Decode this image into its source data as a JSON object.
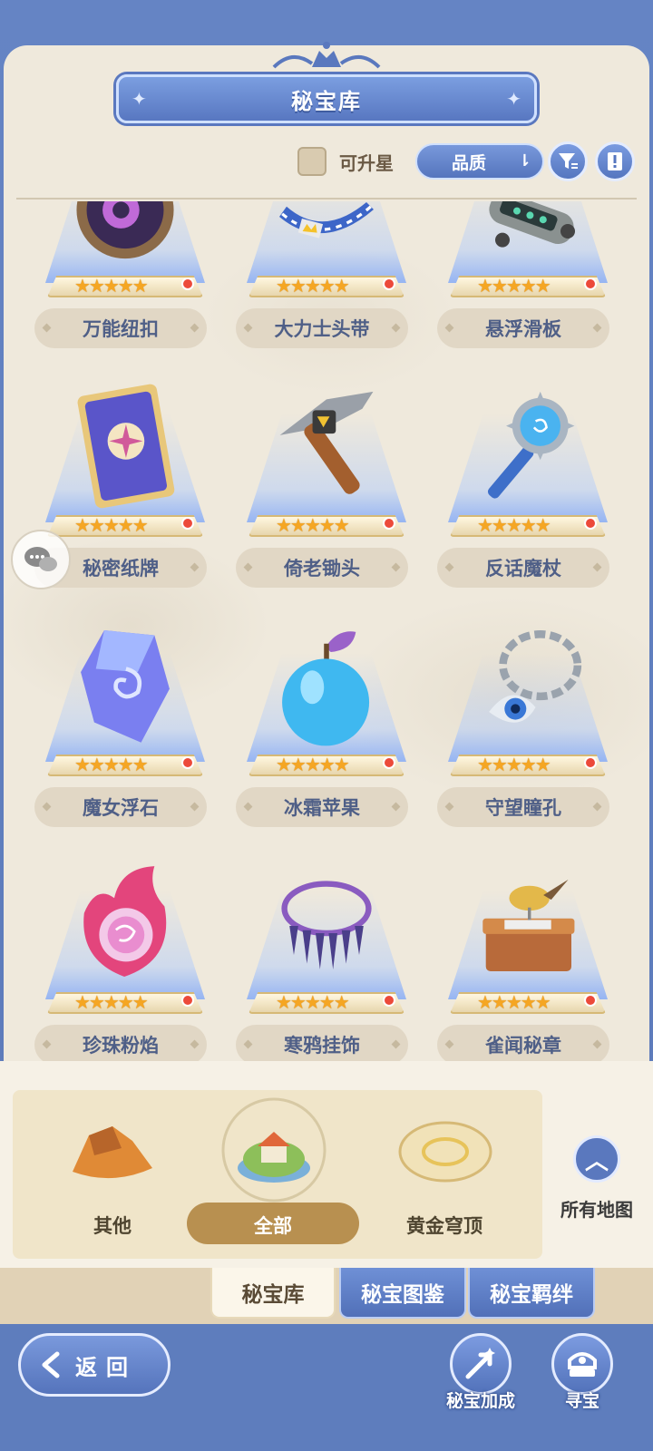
{
  "header": {
    "title": "秘宝库"
  },
  "filters": {
    "upgradable_label": "可升星",
    "quality_label": "品质"
  },
  "items": [
    {
      "name": "万能纽扣",
      "stars": "★★★★★",
      "icon": "button-artifact-icon"
    },
    {
      "name": "大力士头带",
      "stars": "★★★★★",
      "icon": "headband-icon"
    },
    {
      "name": "悬浮滑板",
      "stars": "★★★★★",
      "icon": "hoverboard-icon"
    },
    {
      "name": "秘密纸牌",
      "stars": "★★★★★",
      "icon": "card-icon"
    },
    {
      "name": "倚老锄头",
      "stars": "★★★★★",
      "icon": "pickaxe-icon"
    },
    {
      "name": "反话魔杖",
      "stars": "★★★★★",
      "icon": "mace-wand-icon"
    },
    {
      "name": "魔女浮石",
      "stars": "★★★★★",
      "icon": "crystal-stone-icon"
    },
    {
      "name": "冰霜苹果",
      "stars": "★★★★★",
      "icon": "apple-icon"
    },
    {
      "name": "守望瞳孔",
      "stars": "★★★★★",
      "icon": "chain-eye-icon"
    },
    {
      "name": "珍珠粉焰",
      "stars": "★★★★★",
      "icon": "pink-flame-icon"
    },
    {
      "name": "寒鸦挂饰",
      "stars": "★★★★★",
      "icon": "feather-necklace-icon"
    },
    {
      "name": "雀闻秘章",
      "stars": "★★★★★",
      "icon": "bird-music-box-icon"
    }
  ],
  "regions": [
    {
      "label": "其他"
    },
    {
      "label": "全部"
    },
    {
      "label": "黄金穹顶"
    }
  ],
  "all_maps_label": "所有地图",
  "tabs": [
    {
      "label": "秘宝库"
    },
    {
      "label": "秘宝图鉴"
    },
    {
      "label": "秘宝羁绊"
    }
  ],
  "bottom": {
    "back_label": "返回",
    "boost_label": "秘宝加成",
    "search_label": "寻宝"
  },
  "colors": {
    "accent": "#5a78be",
    "paper": "#efe9dc",
    "star": "#f5a623",
    "badge": "#ec4a3a"
  }
}
